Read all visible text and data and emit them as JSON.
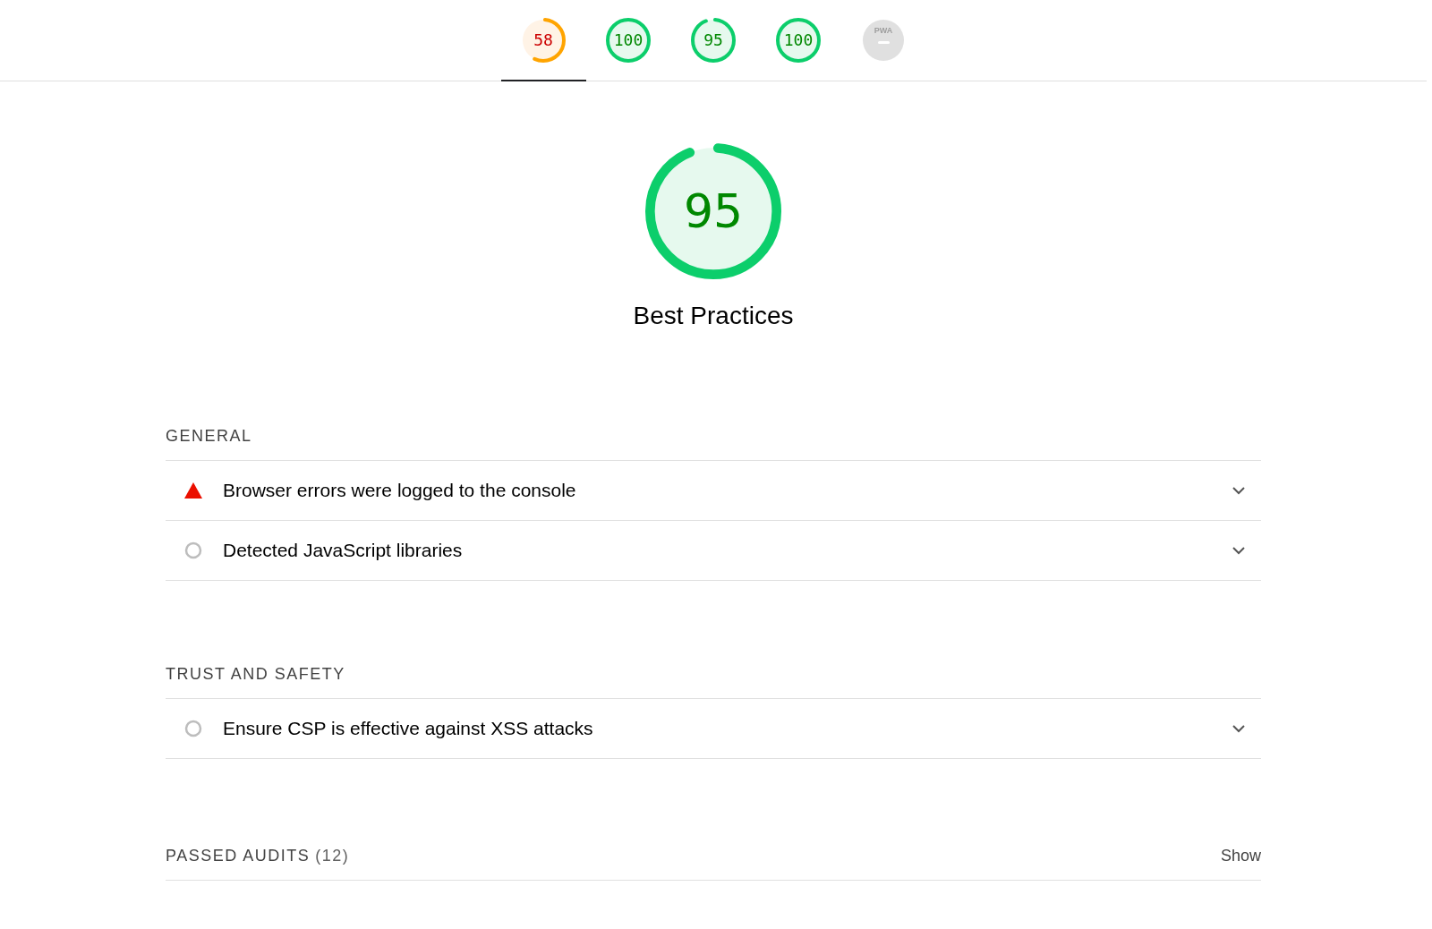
{
  "score_tabs": [
    {
      "score": "58",
      "selected": true
    },
    {
      "score": "100",
      "selected": false
    },
    {
      "score": "95",
      "selected": false
    },
    {
      "score": "100",
      "selected": false
    },
    {
      "label": "PWA",
      "selected": false
    }
  ],
  "category": {
    "score": "95",
    "title": "Best Practices"
  },
  "groups": [
    {
      "title": "GENERAL",
      "audits": [
        {
          "kind": "fail",
          "title": "Browser errors were logged to the console"
        },
        {
          "kind": "info",
          "title": "Detected JavaScript libraries"
        }
      ]
    },
    {
      "title": "TRUST AND SAFETY",
      "audits": [
        {
          "kind": "info",
          "title": "Ensure CSP is effective against XSS attacks"
        }
      ]
    }
  ],
  "passed": {
    "label": "PASSED AUDITS",
    "count": "(12)",
    "toggle": "Show"
  }
}
